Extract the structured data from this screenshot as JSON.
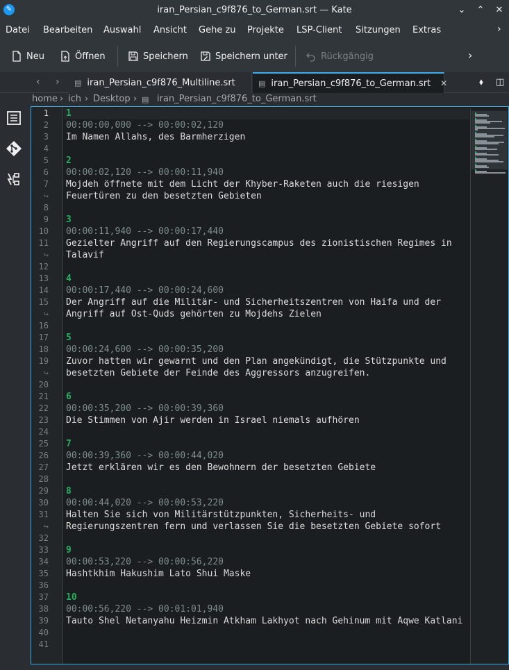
{
  "window": {
    "title": "iran_Persian_c9f876_to_German.srt — Kate"
  },
  "menu": [
    "Datei",
    "Bearbeiten",
    "Auswahl",
    "Ansicht",
    "Gehe zu",
    "Projekte",
    "LSP-Client",
    "Sitzungen",
    "Extras"
  ],
  "toolbar": {
    "new": "Neu",
    "open": "Öffnen",
    "save": "Speichern",
    "save_as": "Speichern unter",
    "undo": "Rückgängig"
  },
  "tabs": [
    {
      "label": "iran_Persian_c9f876_Multiline.srt",
      "active": false
    },
    {
      "label": "iran_Persian_c9f876_to_German.srt",
      "active": true
    }
  ],
  "breadcrumb": [
    "home",
    "ich",
    "Desktop",
    "iran_Persian_c9f876_to_German.srt"
  ],
  "colors": {
    "accent": "#3daee9",
    "subtitle_number": "#27ae60",
    "timestamp": "#7f8c8d"
  },
  "lines": [
    {
      "n": "1",
      "t": "1",
      "k": "num"
    },
    {
      "n": "2",
      "t": "00:00:00,000 --> 00:00:02,120",
      "k": "time"
    },
    {
      "n": "3",
      "t": "Im Namen Allahs, des Barmherzigen",
      "k": "text"
    },
    {
      "n": "4",
      "t": "",
      "k": "text"
    },
    {
      "n": "5",
      "t": "2",
      "k": "num"
    },
    {
      "n": "6",
      "t": "00:00:02,120 --> 00:00:11,940",
      "k": "time"
    },
    {
      "n": "7",
      "t": "Mojdeh öffnete mit dem Licht der Khyber-Raketen auch die riesigen",
      "k": "text"
    },
    {
      "n": "↪",
      "t": "Feuertüren zu den besetzten Gebieten",
      "k": "text",
      "w": true
    },
    {
      "n": "8",
      "t": "",
      "k": "text"
    },
    {
      "n": "9",
      "t": "3",
      "k": "num"
    },
    {
      "n": "10",
      "t": "00:00:11,940 --> 00:00:17,440",
      "k": "time"
    },
    {
      "n": "11",
      "t": "Gezielter Angriff auf den Regierungscampus des zionistischen Regimes in",
      "k": "text"
    },
    {
      "n": "↪",
      "t": "Talavif",
      "k": "text",
      "w": true
    },
    {
      "n": "12",
      "t": "",
      "k": "text"
    },
    {
      "n": "13",
      "t": "4",
      "k": "num"
    },
    {
      "n": "14",
      "t": "00:00:17,440 --> 00:00:24,600",
      "k": "time"
    },
    {
      "n": "15",
      "t": "Der Angriff auf die Militär- und Sicherheitszentren von Haifa und der",
      "k": "text"
    },
    {
      "n": "↪",
      "t": "Angriff auf Ost-Quds gehörten zu Mojdehs Zielen",
      "k": "text",
      "w": true
    },
    {
      "n": "16",
      "t": "",
      "k": "text"
    },
    {
      "n": "17",
      "t": "5",
      "k": "num"
    },
    {
      "n": "18",
      "t": "00:00:24,600 --> 00:00:35,200",
      "k": "time"
    },
    {
      "n": "19",
      "t": "Zuvor hatten wir gewarnt und den Plan angekündigt, die Stützpunkte und",
      "k": "text"
    },
    {
      "n": "↪",
      "t": "besetzten Gebiete der Feinde des Aggressors anzugreifen.",
      "k": "text",
      "w": true
    },
    {
      "n": "20",
      "t": "",
      "k": "text"
    },
    {
      "n": "21",
      "t": "6",
      "k": "num"
    },
    {
      "n": "22",
      "t": "00:00:35,200 --> 00:00:39,360",
      "k": "time"
    },
    {
      "n": "23",
      "t": "Die Stimmen von Ajir werden in Israel niemals aufhören",
      "k": "text"
    },
    {
      "n": "24",
      "t": "",
      "k": "text"
    },
    {
      "n": "25",
      "t": "7",
      "k": "num"
    },
    {
      "n": "26",
      "t": "00:00:39,360 --> 00:00:44,020",
      "k": "time"
    },
    {
      "n": "27",
      "t": "Jetzt erklären wir es den Bewohnern der besetzten Gebiete",
      "k": "text"
    },
    {
      "n": "28",
      "t": "",
      "k": "text"
    },
    {
      "n": "29",
      "t": "8",
      "k": "num"
    },
    {
      "n": "30",
      "t": "00:00:44,020 --> 00:00:53,220",
      "k": "time"
    },
    {
      "n": "31",
      "t": "Halten Sie sich von Militärstützpunkten, Sicherheits- und",
      "k": "text"
    },
    {
      "n": "↪",
      "t": "Regierungszentren fern und verlassen Sie die besetzten Gebiete sofort",
      "k": "text",
      "w": true
    },
    {
      "n": "32",
      "t": "",
      "k": "text"
    },
    {
      "n": "33",
      "t": "9",
      "k": "num"
    },
    {
      "n": "34",
      "t": "00:00:53,220 --> 00:00:56,220",
      "k": "time"
    },
    {
      "n": "35",
      "t": "Hashtkhim Hakushim Lato Shui Maske",
      "k": "text"
    },
    {
      "n": "36",
      "t": "",
      "k": "text"
    },
    {
      "n": "37",
      "t": "10",
      "k": "num"
    },
    {
      "n": "38",
      "t": "00:00:56,220 --> 00:01:01,940",
      "k": "time"
    },
    {
      "n": "39",
      "t": "Tauto Shel Netanyahu Heizmin Atkham Lakhyot nach Gehinum mit Aqwe Katlani",
      "k": "text"
    },
    {
      "n": "40",
      "t": "",
      "k": "text"
    },
    {
      "n": "41",
      "t": "",
      "k": "text"
    }
  ]
}
